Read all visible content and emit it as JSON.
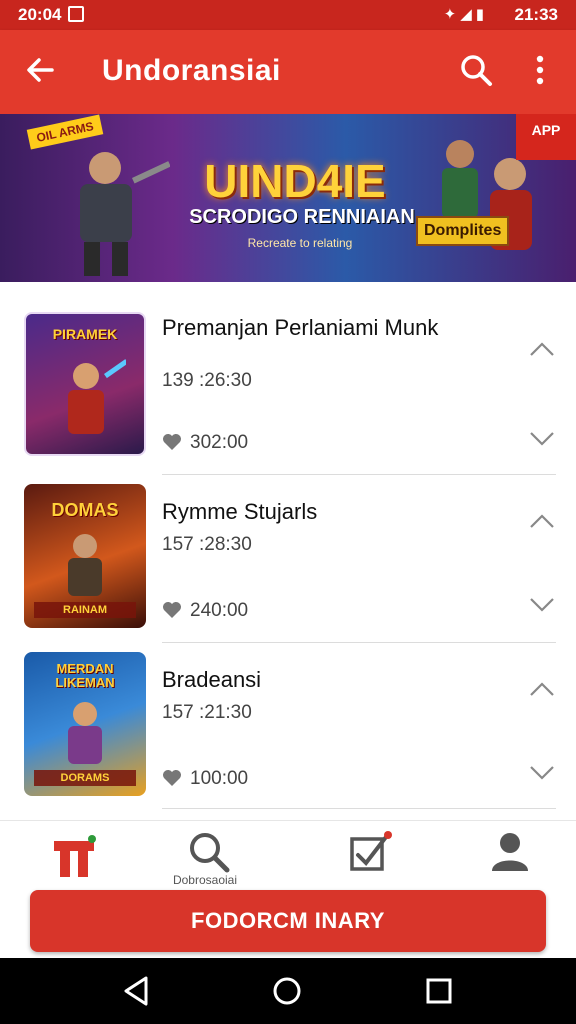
{
  "status_bar": {
    "time_left": "20:04",
    "time_right": "21:33"
  },
  "app_bar": {
    "title": "Undoransiai"
  },
  "banner": {
    "flash": "OIL ARMS",
    "corner": "APP",
    "headline": "UIND4IE",
    "subtitle": "SCRODIGO RENNIAIAN",
    "tagline": "Recreate to relating",
    "badge": "Domplites"
  },
  "items": [
    {
      "name": "Premanjan Perlaniami Munk",
      "duration": "139 :26:30",
      "likes": "302:00",
      "thumb_title": "PIRAMEK",
      "thumb_foot": ""
    },
    {
      "name": "Rymme Stujarls",
      "duration": "157 :28:30",
      "likes": "240:00",
      "thumb_title": "DOMAS",
      "thumb_foot": "RAINAM"
    },
    {
      "name": "Bradeansi",
      "duration": "157 :21:30",
      "likes": "100:00",
      "thumb_title": "MERDAN LIKEMAN",
      "thumb_foot": "DORAMS"
    }
  ],
  "bottom_nav": {
    "search_label": "Dobrosaoiai"
  },
  "cta": {
    "label": "FODORCM INARY"
  },
  "colors": {
    "primary": "#e23a2c",
    "status": "#c8261e",
    "cta": "#d8352a"
  }
}
